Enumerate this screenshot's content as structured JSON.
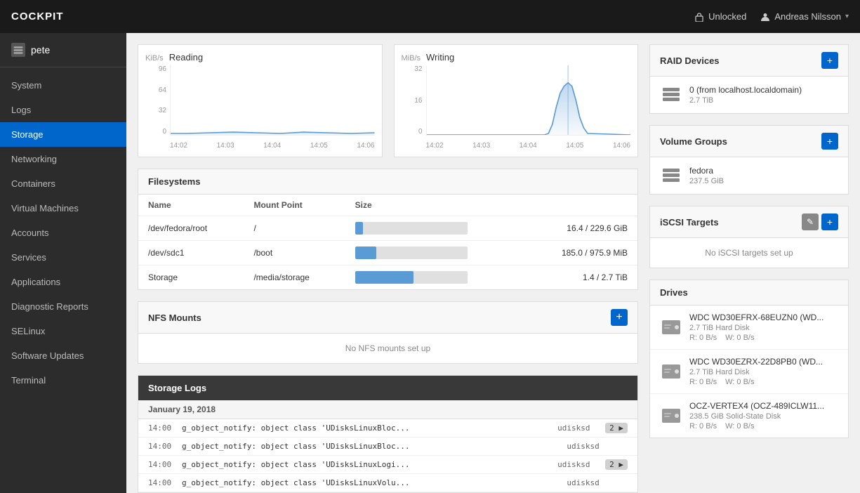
{
  "topbar": {
    "brand": "COCKPIT",
    "unlock_label": "Unlocked",
    "user_label": "Andreas Nilsson",
    "user_chevron": "▾"
  },
  "sidebar": {
    "host_icon": "☰",
    "host_name": "pete",
    "nav_items": [
      {
        "id": "system",
        "label": "System"
      },
      {
        "id": "logs",
        "label": "Logs"
      },
      {
        "id": "storage",
        "label": "Storage",
        "active": true
      },
      {
        "id": "networking",
        "label": "Networking"
      },
      {
        "id": "containers",
        "label": "Containers"
      },
      {
        "id": "virtual-machines",
        "label": "Virtual Machines"
      },
      {
        "id": "accounts",
        "label": "Accounts"
      },
      {
        "id": "services",
        "label": "Services"
      },
      {
        "id": "applications",
        "label": "Applications"
      },
      {
        "id": "diagnostic-reports",
        "label": "Diagnostic Reports"
      },
      {
        "id": "selinux",
        "label": "SELinux"
      },
      {
        "id": "software-updates",
        "label": "Software Updates"
      },
      {
        "id": "terminal",
        "label": "Terminal"
      }
    ]
  },
  "reading_chart": {
    "unit": "KiB/s",
    "title": "Reading",
    "y_labels": [
      "96",
      "64",
      "32",
      "0"
    ],
    "x_labels": [
      "14:02",
      "14:03",
      "14:04",
      "14:05",
      "14:06"
    ]
  },
  "writing_chart": {
    "unit": "MiB/s",
    "title": "Writing",
    "y_labels": [
      "32",
      "16",
      "0"
    ],
    "x_labels": [
      "14:02",
      "14:03",
      "14:04",
      "14:05",
      "14:06"
    ]
  },
  "filesystems": {
    "title": "Filesystems",
    "columns": [
      "Name",
      "Mount Point",
      "Size"
    ],
    "rows": [
      {
        "name": "/dev/fedora/root",
        "mount": "/",
        "size": "16.4 / 229.6 GiB",
        "pct": 7
      },
      {
        "name": "/dev/sdc1",
        "mount": "/boot",
        "size": "185.0 / 975.9 MiB",
        "pct": 19
      },
      {
        "name": "Storage",
        "mount": "/media/storage",
        "size": "1.4 / 2.7 TiB",
        "pct": 52
      }
    ]
  },
  "nfs": {
    "title": "NFS Mounts",
    "add_label": "+",
    "empty_label": "No NFS mounts set up"
  },
  "storage_logs": {
    "title": "Storage Logs",
    "date": "January 19, 2018",
    "rows": [
      {
        "time": "14:00",
        "msg": "g_object_notify: object class 'UDisksLinuxBloc...",
        "service": "udisksd",
        "badge": "2"
      },
      {
        "time": "14:00",
        "msg": "g_object_notify: object class 'UDisksLinuxBloc...",
        "service": "udisksd",
        "badge": ""
      },
      {
        "time": "14:00",
        "msg": "g_object_notify: object class 'UDisksLinuxLogi...",
        "service": "udisksd",
        "badge": "2"
      },
      {
        "time": "14:00",
        "msg": "g_object_notify: object class 'UDisksLinuxVolu...",
        "service": "udisksd",
        "badge": ""
      }
    ]
  },
  "raid_devices": {
    "title": "RAID Devices",
    "add_label": "+",
    "items": [
      {
        "name": "0 (from localhost.localdomain)",
        "sub": "2.7 TiB"
      }
    ]
  },
  "volume_groups": {
    "title": "Volume Groups",
    "add_label": "+",
    "items": [
      {
        "name": "fedora",
        "sub": "237.5 GiB"
      }
    ]
  },
  "iscsi_targets": {
    "title": "iSCSI Targets",
    "edit_label": "✎",
    "add_label": "+",
    "empty_label": "No iSCSI targets set up"
  },
  "drives": {
    "title": "Drives",
    "items": [
      {
        "name": "WDC WD30EFRX-68EUZN0 (WD...",
        "sub": "2.7 TiB Hard Disk",
        "read": "R: 0 B/s",
        "write": "W: 0 B/s"
      },
      {
        "name": "WDC WD30EZRX-22D8PB0 (WD...",
        "sub": "2.7 TiB Hard Disk",
        "read": "R: 0 B/s",
        "write": "W: 0 B/s"
      },
      {
        "name": "OCZ-VERTEX4 (OCZ-489ICLW11...",
        "sub": "238.5 GiB Solid-State Disk",
        "read": "R: 0 B/s",
        "write": "W: 0 B/s"
      }
    ]
  }
}
